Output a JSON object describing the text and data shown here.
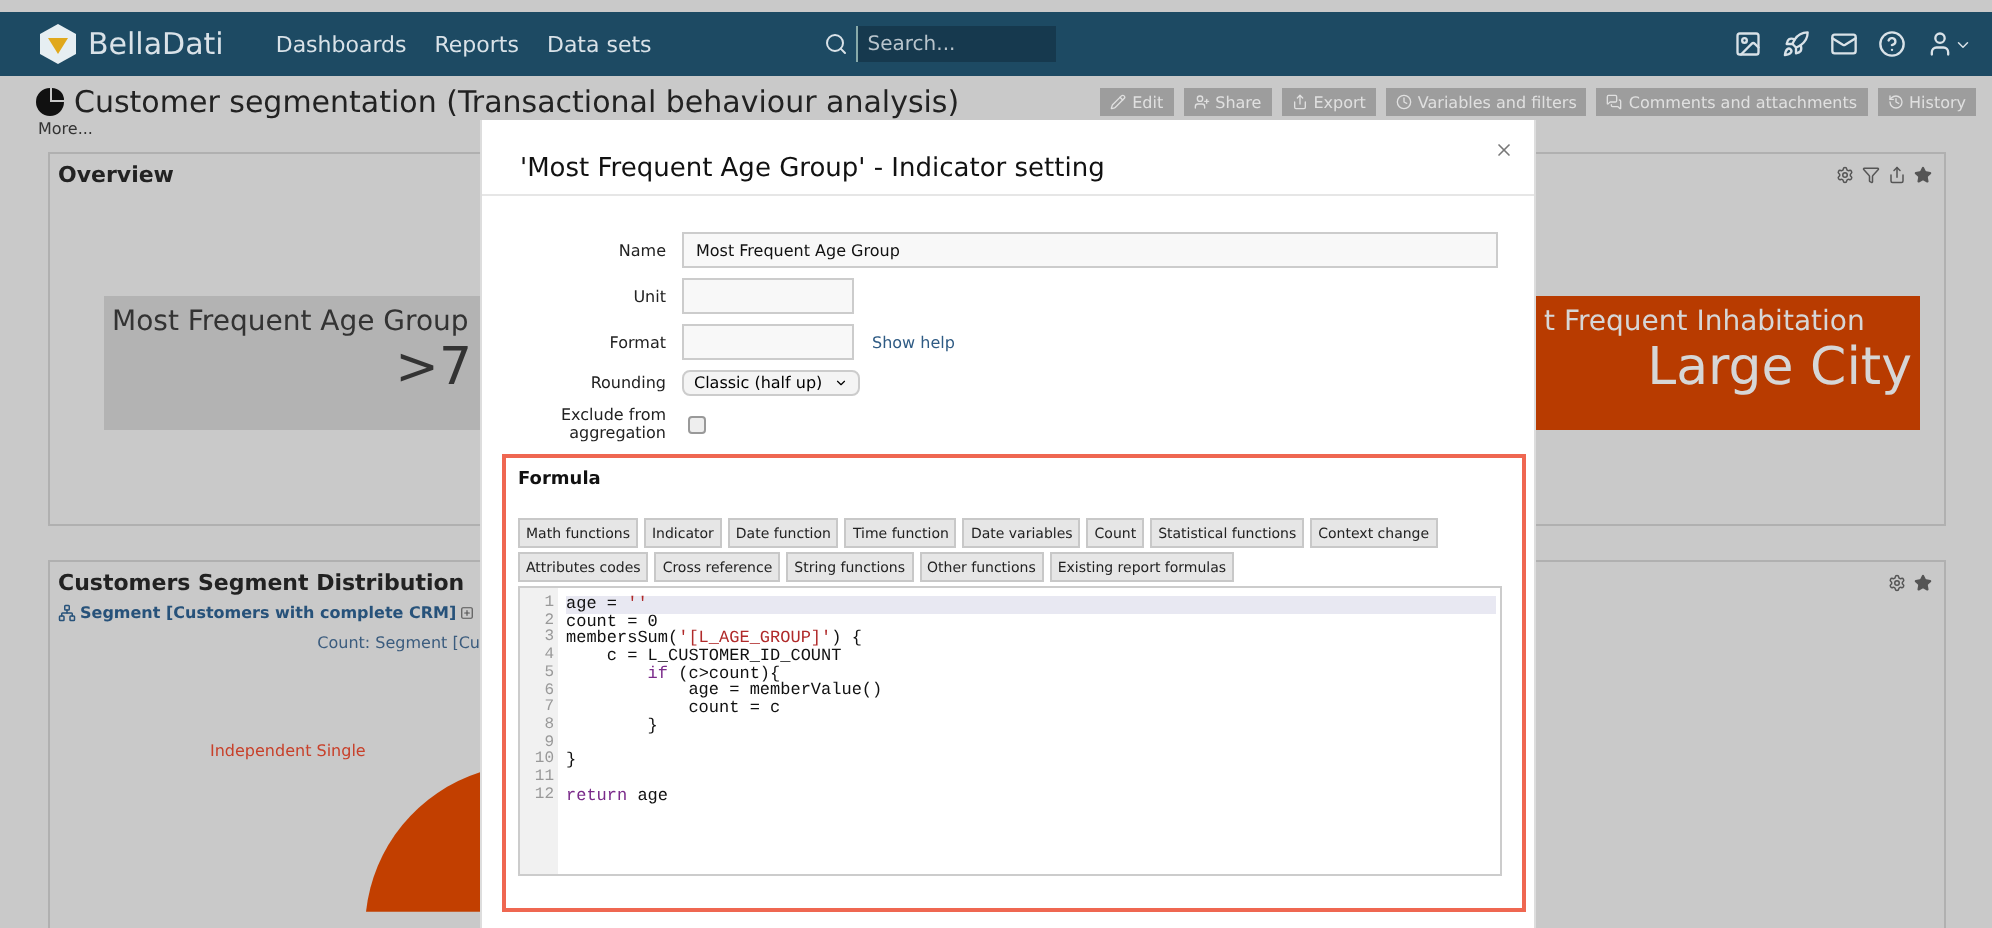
{
  "header": {
    "brand": "BellaDati",
    "nav": [
      "Dashboards",
      "Reports",
      "Data sets"
    ],
    "search": {
      "placeholder": "Search..."
    }
  },
  "report": {
    "title": "Customer segmentation (Transactional behaviour analysis)",
    "more": "More...",
    "actions": [
      {
        "label": "Edit",
        "kind": "edit"
      },
      {
        "label": "Share",
        "kind": "share"
      },
      {
        "label": "Export",
        "kind": "export"
      },
      {
        "label": "Variables and filters",
        "kind": "variables"
      },
      {
        "label": "Comments and attachments",
        "kind": "comments"
      },
      {
        "label": "History",
        "kind": "history"
      }
    ]
  },
  "overview": {
    "title": "Overview",
    "tiles": [
      {
        "label": "Most Frequent Age Group",
        "value": ">7",
        "kind": "neutral"
      },
      {
        "label": "t Frequent Inhabitation",
        "value": "Large City",
        "kind": "highlight"
      }
    ]
  },
  "distribution": {
    "title": "Customers Segment Distribution",
    "segment_link": "Segment [Customers with complete CRM]",
    "count_label": "Count: Segment [Cu",
    "slice_label": "Independent Single"
  },
  "dialog": {
    "title": "'Most Frequent Age Group' - Indicator setting",
    "fields": [
      {
        "label": "Name",
        "kind": "text",
        "value": "Most Frequent Age Group"
      },
      {
        "label": "Unit",
        "kind": "short"
      },
      {
        "label": "Format",
        "kind": "short",
        "help": "Show help"
      },
      {
        "label": "Rounding",
        "kind": "select",
        "value": "Classic (half up)"
      },
      {
        "label": "Exclude from aggregation",
        "kind": "checkbox",
        "checked": false
      }
    ],
    "formula": {
      "title": "Formula",
      "button_rows": [
        [
          "Math functions",
          "Indicator",
          "Date function",
          "Time function",
          "Date variables",
          "Count",
          "Statistical functions",
          "Context change"
        ],
        [
          "Attributes codes",
          "Cross reference",
          "String functions",
          "Other functions",
          "Existing report formulas"
        ]
      ],
      "lines": [
        {
          "number": "1",
          "active": true,
          "tokens": [
            {
              "text": "age = ",
              "kind": "plain"
            },
            {
              "text": "''",
              "kind": "string"
            }
          ]
        },
        {
          "number": "2",
          "active": false,
          "tokens": [
            {
              "text": "count = 0",
              "kind": "plain"
            }
          ]
        },
        {
          "number": "3",
          "active": false,
          "tokens": [
            {
              "text": "membersSum(",
              "kind": "plain"
            },
            {
              "text": "'[L_AGE_GROUP]'",
              "kind": "string"
            },
            {
              "text": ") {",
              "kind": "plain"
            }
          ]
        },
        {
          "number": "4",
          "active": false,
          "tokens": [
            {
              "text": "    c = L_CUSTOMER_ID_COUNT",
              "kind": "plain"
            }
          ]
        },
        {
          "number": "5",
          "active": false,
          "tokens": [
            {
              "text": "        if",
              "kind": "keyword"
            },
            {
              "text": " (c>count){",
              "kind": "plain"
            }
          ]
        },
        {
          "number": "6",
          "active": false,
          "tokens": [
            {
              "text": "            age = memberValue()",
              "kind": "plain"
            }
          ]
        },
        {
          "number": "7",
          "active": false,
          "tokens": [
            {
              "text": "            count = c",
              "kind": "plain"
            }
          ]
        },
        {
          "number": "8",
          "active": false,
          "tokens": [
            {
              "text": "        }",
              "kind": "plain"
            }
          ]
        },
        {
          "number": "9",
          "active": false
        },
        {
          "number": "10",
          "active": false,
          "tokens": [
            {
              "text": "}",
              "kind": "plain"
            }
          ]
        },
        {
          "number": "11",
          "active": false
        },
        {
          "number": "12",
          "active": false,
          "tokens": [
            {
              "text": "return",
              "kind": "keyword"
            },
            {
              "text": " age",
              "kind": "plain"
            }
          ]
        }
      ]
    }
  }
}
